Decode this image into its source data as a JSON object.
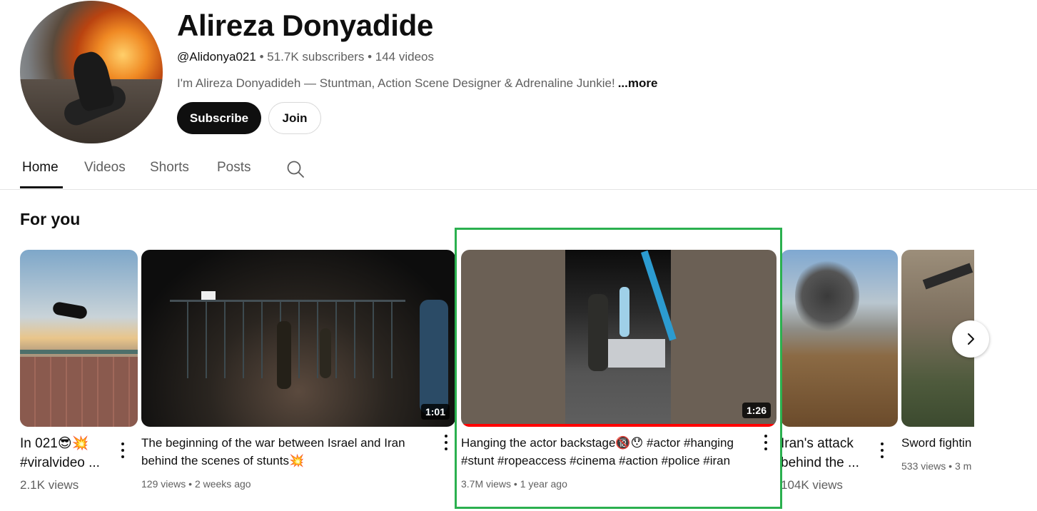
{
  "channel": {
    "name": "Alireza Donyadide",
    "handle": "@Alidonya021",
    "subscribers": "51.7K subscribers",
    "video_count": "144 videos",
    "separator": "•",
    "description": "I'm Alireza Donyadideh — Stuntman, Action Scene Designer & Adrenaline Junkie!",
    "more_label": "...more",
    "subscribe_label": "Subscribe",
    "join_label": "Join"
  },
  "tabs": [
    {
      "label": "Home",
      "active": true
    },
    {
      "label": "Videos",
      "active": false
    },
    {
      "label": "Shorts",
      "active": false
    },
    {
      "label": "Posts",
      "active": false
    }
  ],
  "section": {
    "title": "For you"
  },
  "videos": [
    {
      "title_lines": [
        "In 021😎💥",
        "#viralvideo ..."
      ],
      "views": "2.1K views",
      "age": "",
      "duration": ""
    },
    {
      "title_lines": [
        "The beginning of the war between Israel and Iran",
        "behind the scenes of stunts💥"
      ],
      "views": "129 views",
      "age": "2 weeks ago",
      "duration": "1:01"
    },
    {
      "title_lines": [
        "Hanging the actor backstage🔞😯 #actor #hanging",
        "#stunt #ropeaccess #cinema #action #police #iran"
      ],
      "views": "3.7M views",
      "age": "1 year ago",
      "duration": "1:26",
      "watched_fraction": 1.0
    },
    {
      "title_lines": [
        "Iran's attack",
        "behind the ..."
      ],
      "views": "104K views",
      "age": "",
      "duration": ""
    },
    {
      "title_lines": [
        "Sword fightin"
      ],
      "views": "533 views",
      "age": "3 m",
      "duration": ""
    }
  ],
  "icons": {
    "search": "search-icon",
    "next": "chevron-right-icon",
    "more": "more-vert-icon"
  },
  "colors": {
    "highlight": "#2bb04f",
    "progress": "#ff0000",
    "subscribe_bg": "#0f0f0f"
  }
}
